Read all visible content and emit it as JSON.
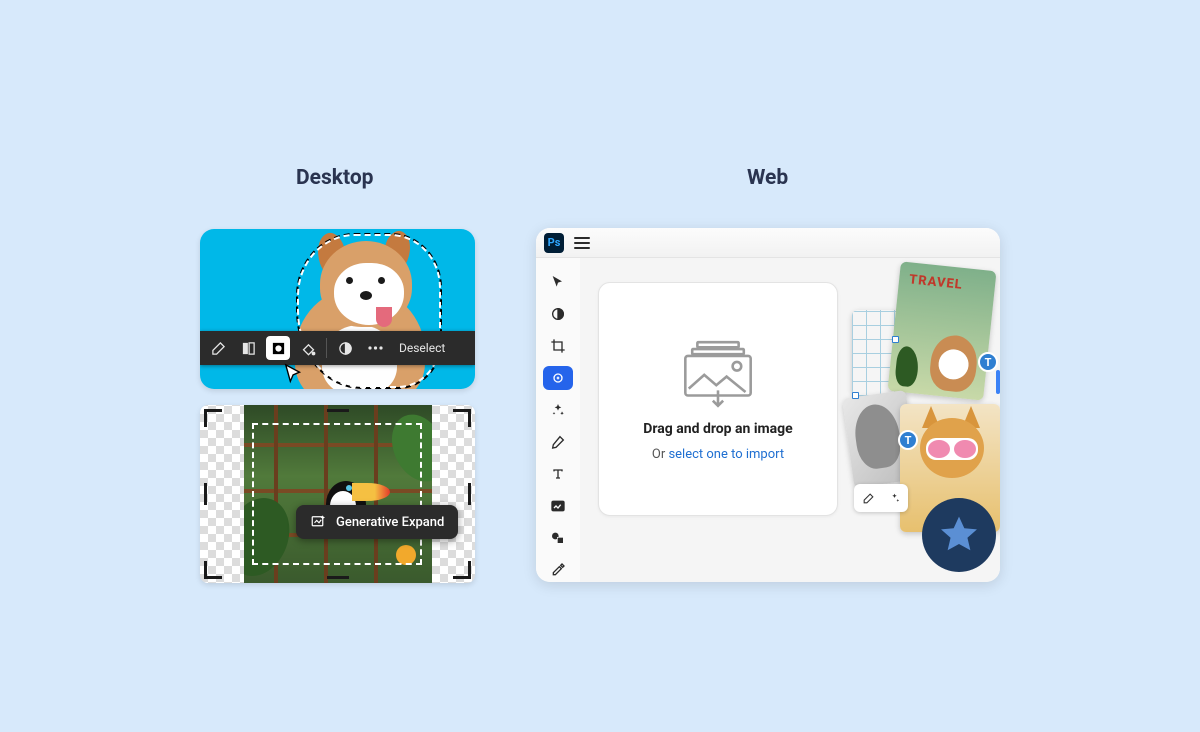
{
  "headings": {
    "desktop": "Desktop",
    "web": "Web"
  },
  "desktop": {
    "context_toolbar": {
      "deselect_label": "Deselect"
    },
    "generative_pill": {
      "label": "Generative Expand"
    }
  },
  "web": {
    "app_badge": "Ps",
    "drop": {
      "title": "Drag and drop an image",
      "or": "Or ",
      "link": "select one to import"
    },
    "collage": {
      "travel_label": "TRAVEL",
      "text_badge": "T"
    }
  }
}
